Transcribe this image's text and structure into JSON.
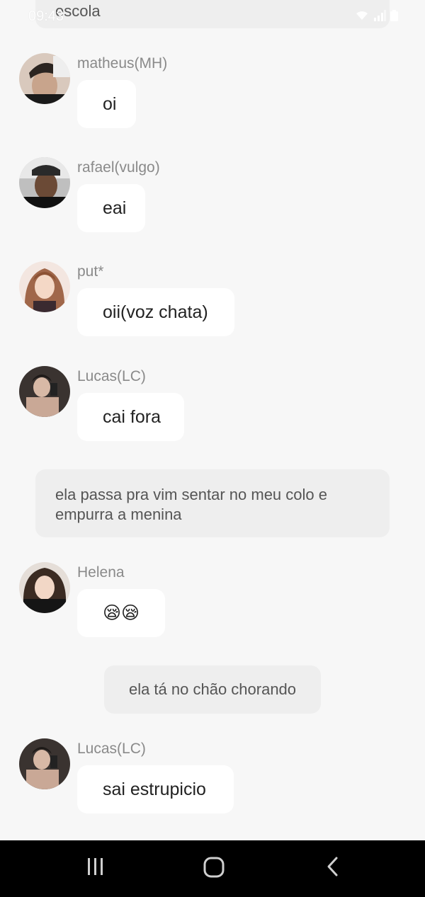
{
  "status_bar": {
    "time": "09:43"
  },
  "narrations": {
    "top": "escola",
    "mid": "ela passa pra vim sentar no meu colo e empurra a menina",
    "low": "ela tá no chão chorando"
  },
  "messages": [
    {
      "sender": "matheus(MH)",
      "text": "oi"
    },
    {
      "sender": "rafael(vulgo)",
      "text": "eai"
    },
    {
      "sender": "put*",
      "text": "oii(voz chata)"
    },
    {
      "sender": "Lucas(LC)",
      "text": "cai fora"
    },
    {
      "sender": "Helena",
      "text": "😪😪"
    },
    {
      "sender": "Lucas(LC)",
      "text": "sai estrupicio"
    }
  ],
  "nav": {
    "recents_icon": "recents-icon",
    "home_icon": "home-icon",
    "back_icon": "back-icon"
  }
}
